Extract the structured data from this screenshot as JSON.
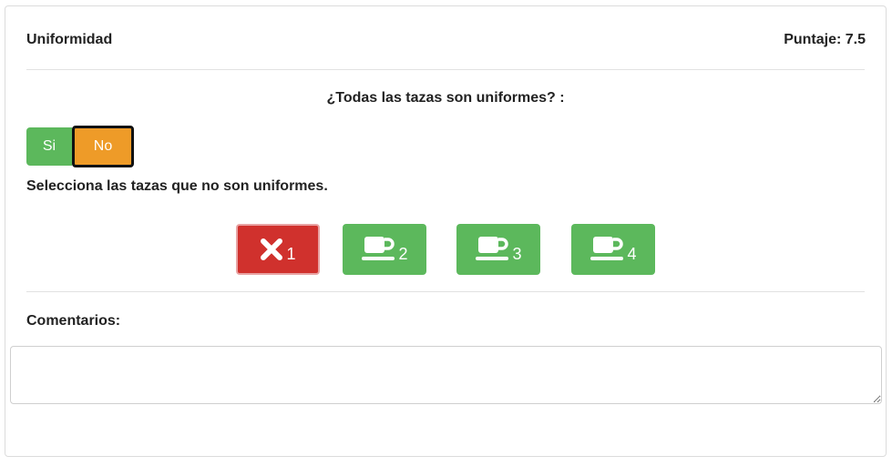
{
  "header": {
    "title": "Uniformidad",
    "score": "Puntaje: 7.5"
  },
  "question": "¿Todas las tazas son uniformes? :",
  "toggle": {
    "yes_label": "Si",
    "no_label": "No",
    "selected": "No"
  },
  "instruction": "Selecciona las tazas que no son uniformes.",
  "cups": [
    {
      "number": "1",
      "selected": true,
      "icon": "x-icon",
      "color": "#d0312d"
    },
    {
      "number": "2",
      "selected": false,
      "icon": "coffee-cup-icon",
      "color": "#5cb85c"
    },
    {
      "number": "3",
      "selected": false,
      "icon": "coffee-cup-icon",
      "color": "#5cb85c"
    },
    {
      "number": "4",
      "selected": false,
      "icon": "coffee-cup-icon",
      "color": "#5cb85c"
    }
  ],
  "comments": {
    "label": "Comentarios:",
    "value": "",
    "placeholder": ""
  },
  "colors": {
    "green": "#5cb85c",
    "orange": "#ee9b28",
    "red": "#d0312d"
  }
}
